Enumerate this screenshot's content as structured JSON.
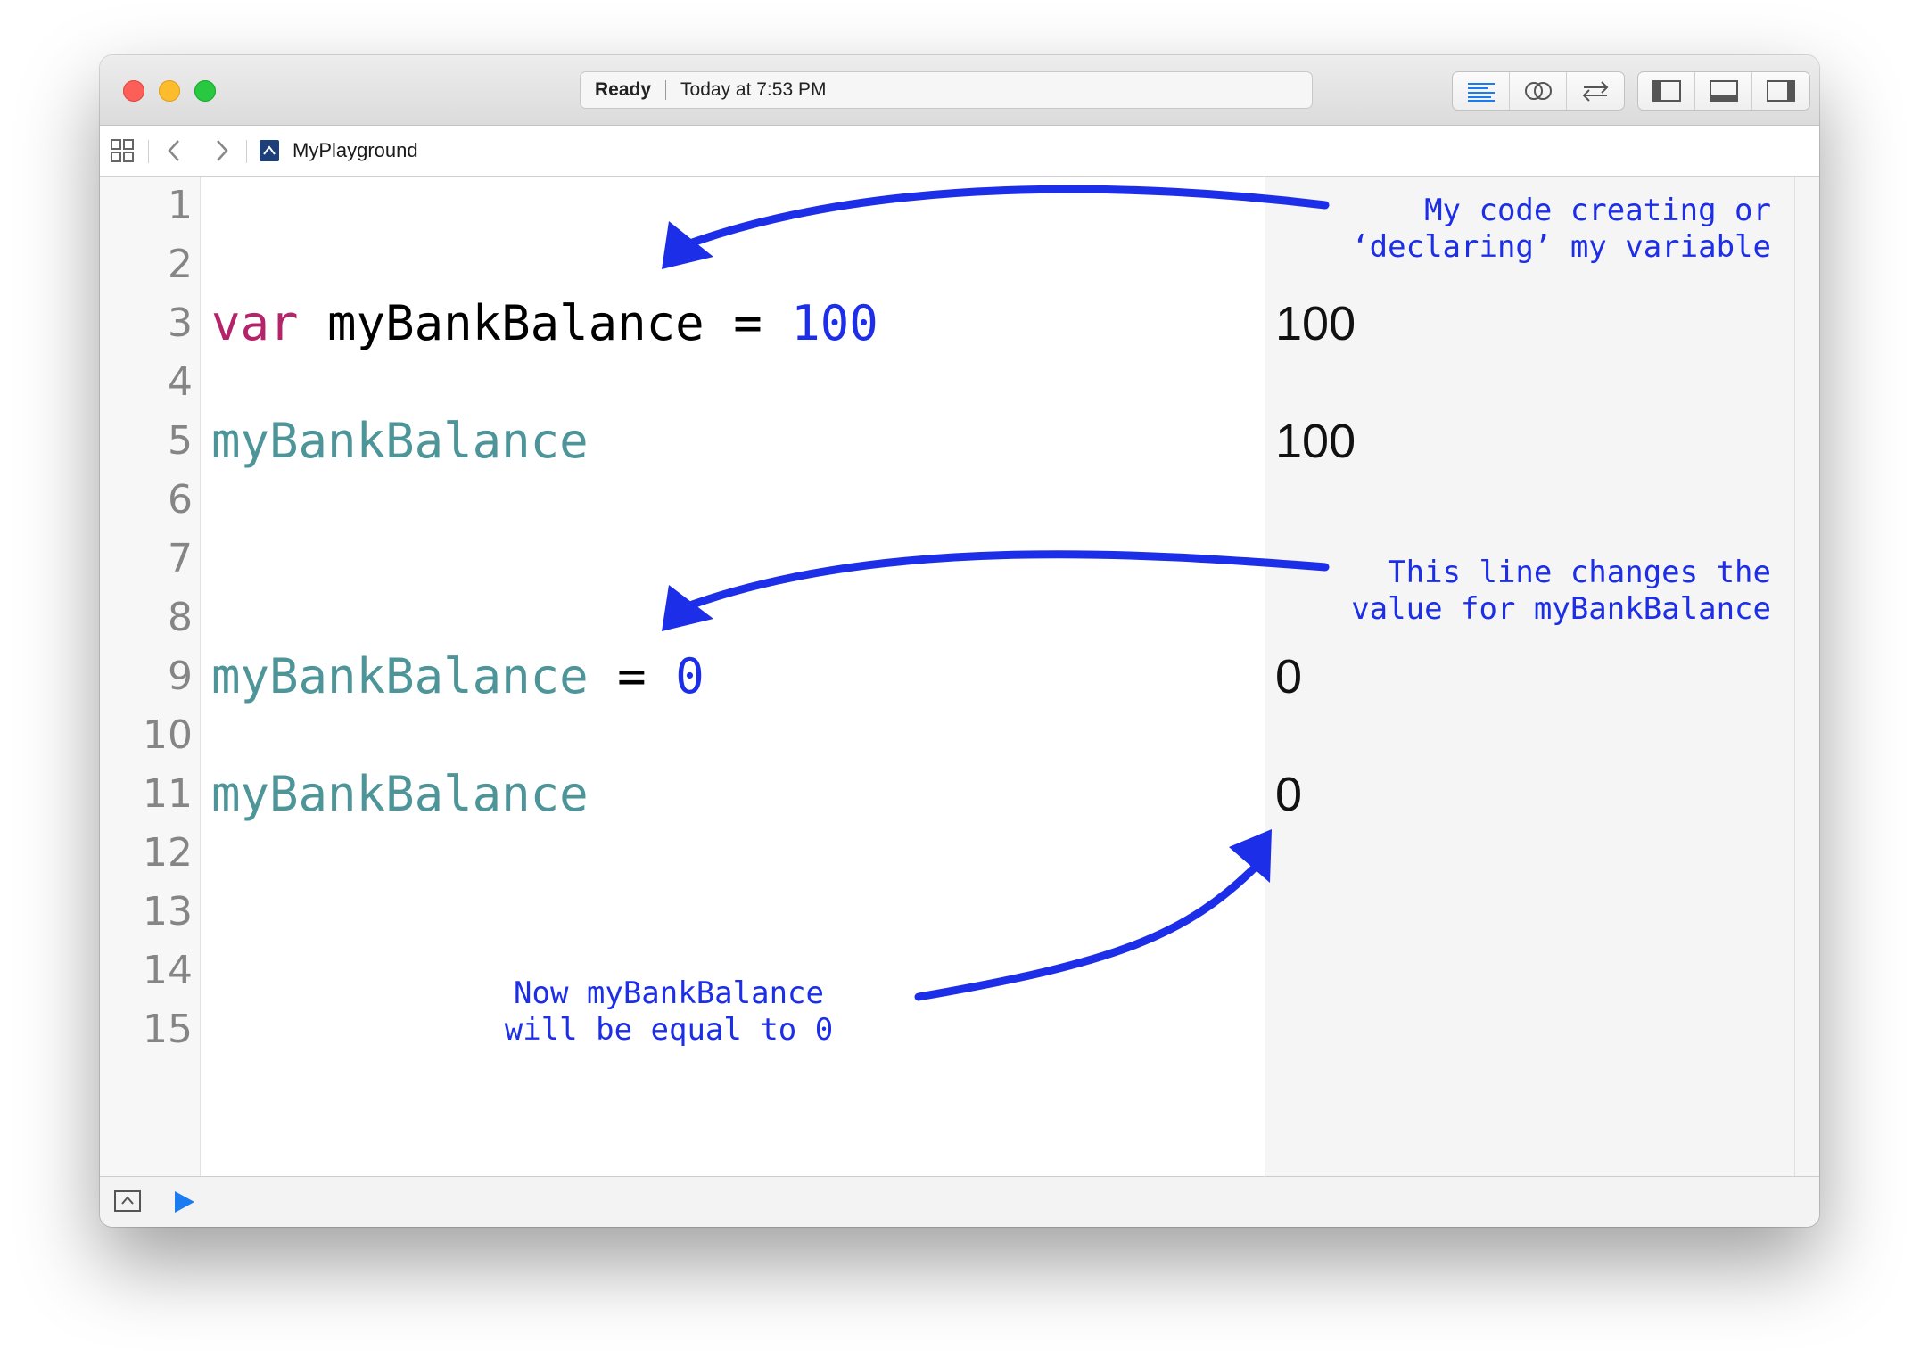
{
  "window": {
    "status_ready": "Ready",
    "status_time": "Today at 7:53 PM",
    "toolbar_icons": [
      "standard-editor-icon",
      "assistant-editor-icon",
      "version-editor-icon",
      "navigator-toggle-icon",
      "debug-area-toggle-icon",
      "utilities-toggle-icon"
    ]
  },
  "jumpbar": {
    "file_name": "MyPlayground"
  },
  "editor": {
    "line_numbers": [
      "1",
      "2",
      "3",
      "4",
      "5",
      "6",
      "7",
      "8",
      "9",
      "10",
      "11",
      "12",
      "13",
      "14",
      "15"
    ],
    "code": {
      "line3_keyword": "var",
      "line3_name": " myBankBalance = ",
      "line3_value": "100",
      "line5_ident": "myBankBalance",
      "line9_ident": "myBankBalance",
      "line9_op": " = ",
      "line9_value": "0",
      "line11_ident": "myBankBalance"
    }
  },
  "results": {
    "line3": "100",
    "line5": "100",
    "line9": "0",
    "line11": "0"
  },
  "annotations": {
    "declare": "My code creating or\n‘declaring’ my variable",
    "change": "This line changes the\nvalue for myBankBalance",
    "now": "Now myBankBalance\nwill be equal to 0"
  },
  "colors": {
    "keyword": "#b4246a",
    "number_literal": "#1c2ee7",
    "identifier": "#4d9598",
    "annotation_ink": "#1c2ee7",
    "run_button": "#1a7cf0"
  }
}
